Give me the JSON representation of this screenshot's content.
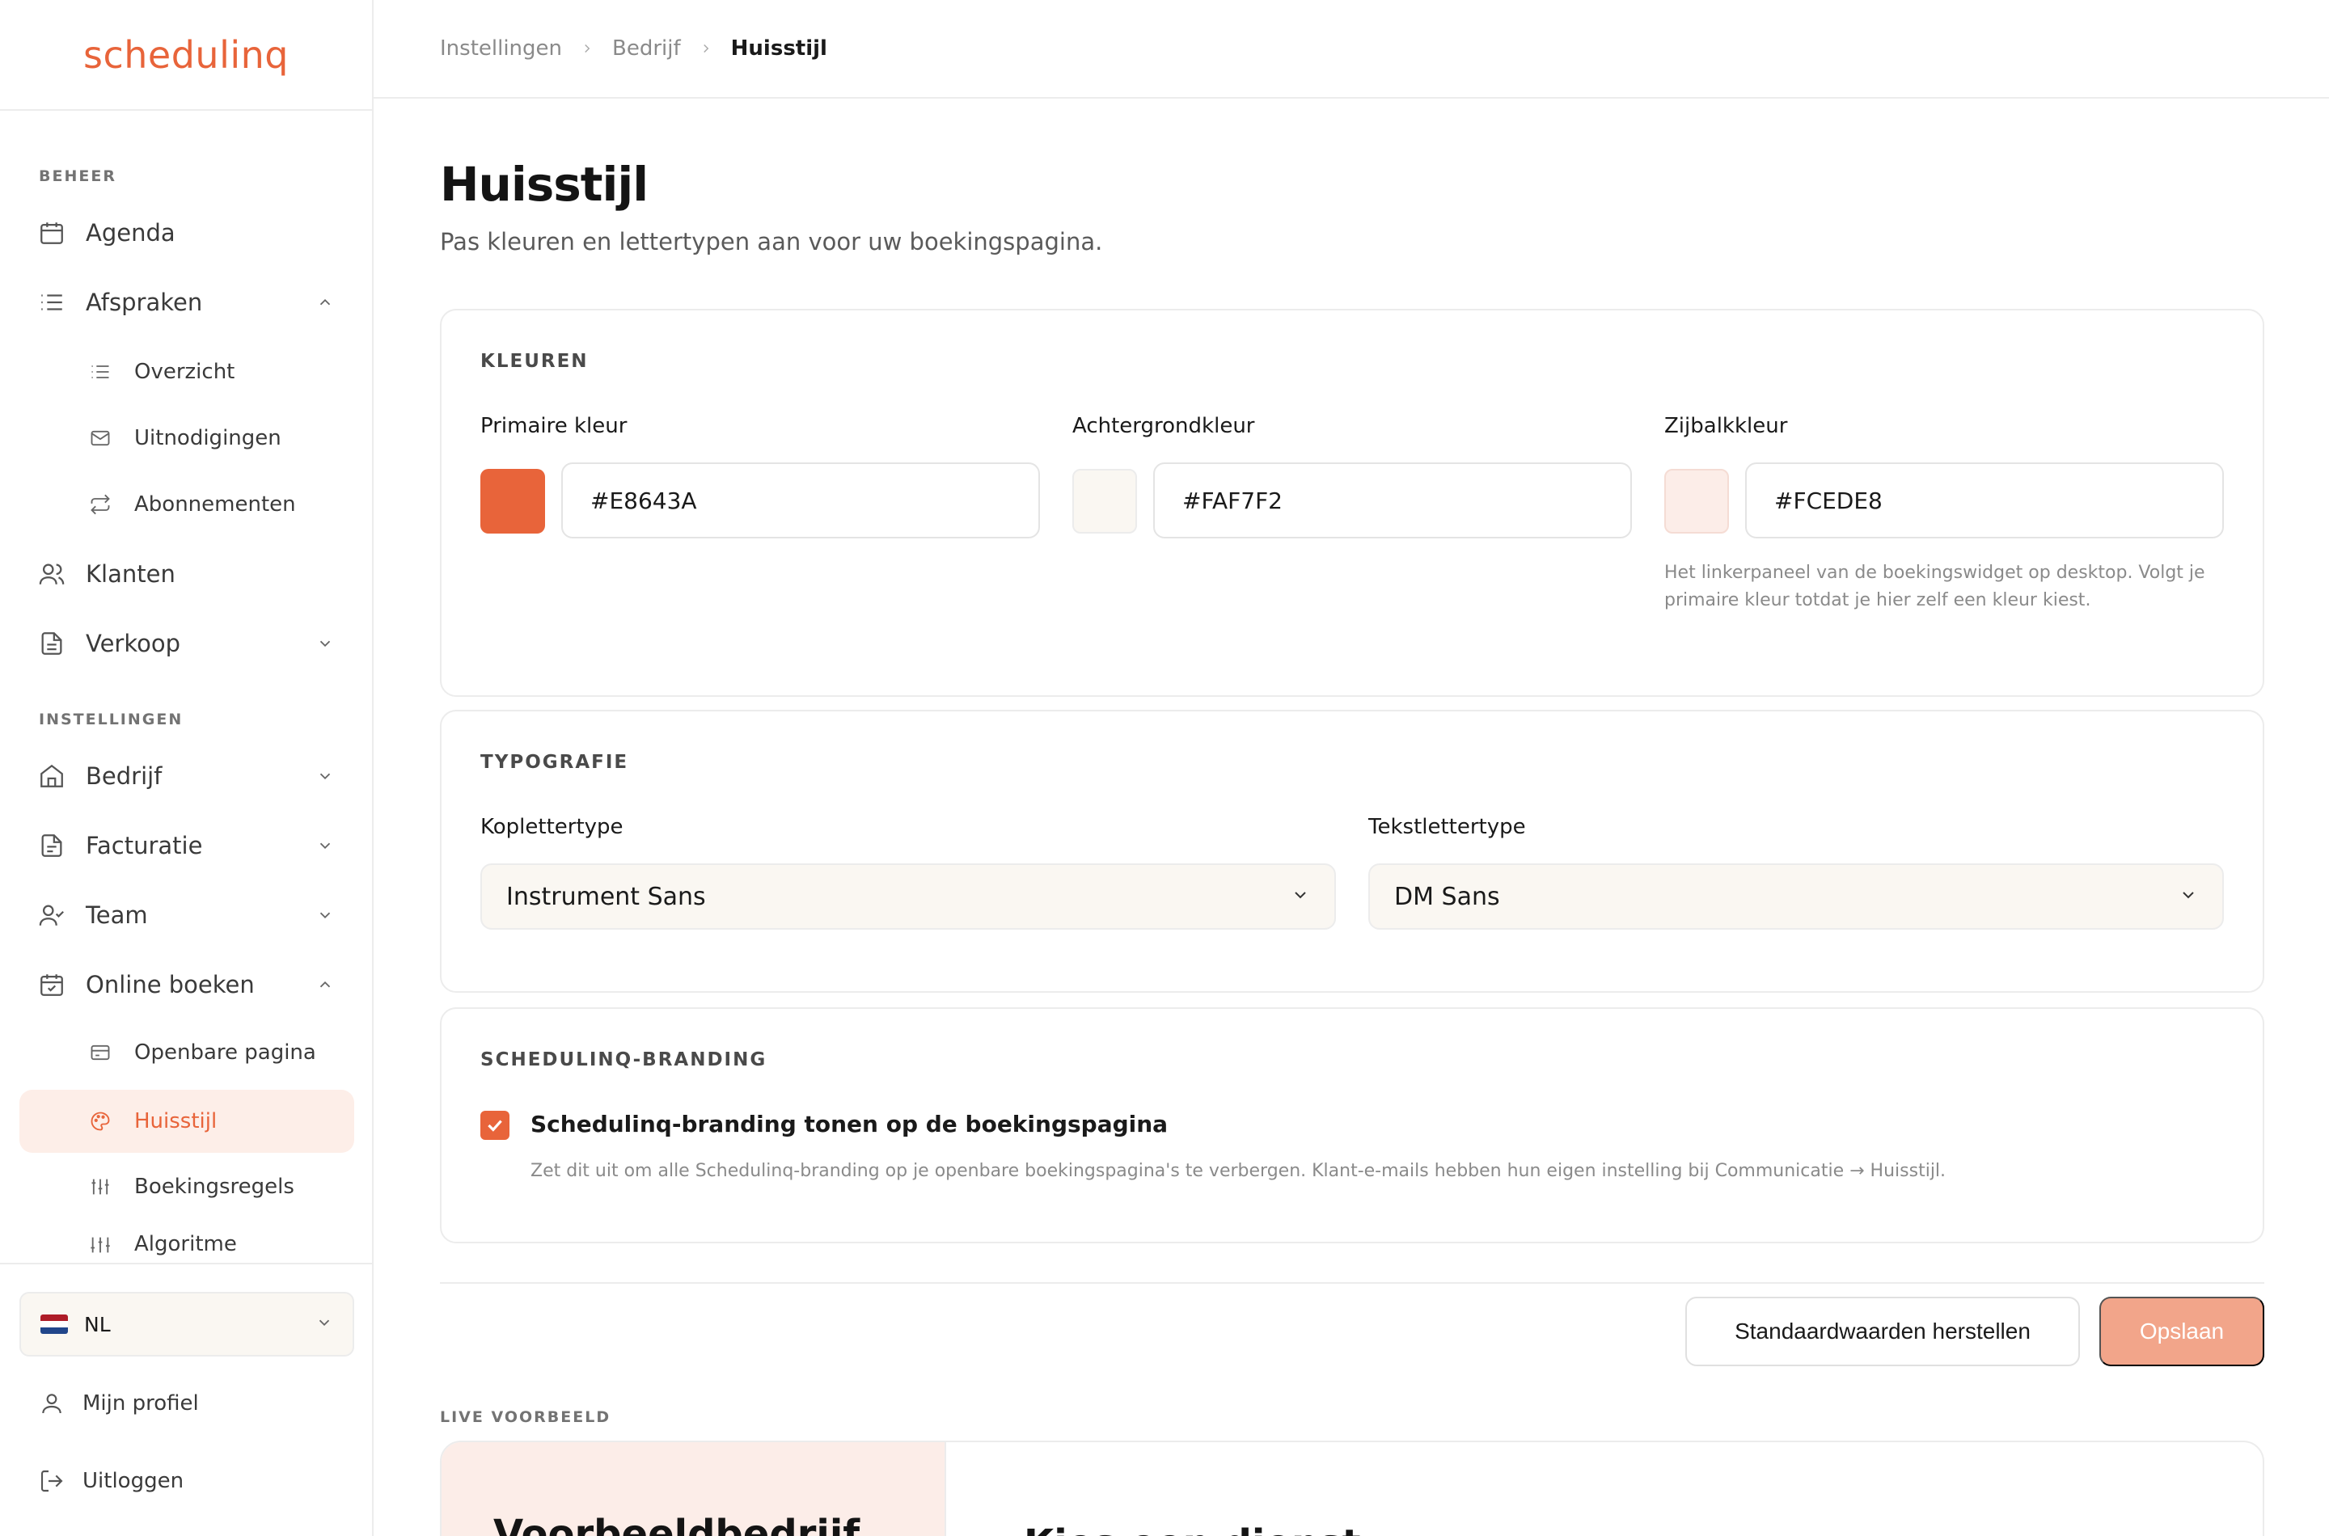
{
  "app": {
    "logo": "schedulinq"
  },
  "sidebar": {
    "section_beheer": "BEHEER",
    "section_instellingen": "INSTELLINGEN",
    "items": {
      "agenda": "Agenda",
      "afspraken": "Afspraken",
      "overzicht": "Overzicht",
      "uitnodigingen": "Uitnodigingen",
      "abonnementen": "Abonnementen",
      "klanten": "Klanten",
      "verkoop": "Verkoop",
      "bedrijf": "Bedrijf",
      "facturatie": "Facturatie",
      "team": "Team",
      "online_boeken": "Online boeken",
      "openbare_pagina": "Openbare pagina",
      "huisstijl": "Huisstijl",
      "boekingsregels": "Boekingsregels",
      "algoritme": "Algoritme"
    },
    "language": "NL",
    "profile": "Mijn profiel",
    "logout": "Uitloggen"
  },
  "breadcrumb": [
    "Instellingen",
    "Bedrijf",
    "Huisstijl"
  ],
  "page": {
    "title": "Huisstijl",
    "subtitle": "Pas kleuren en lettertypen aan voor uw boekingspagina."
  },
  "colors_card": {
    "title": "KLEUREN",
    "primary": {
      "label": "Primaire kleur",
      "value": "#E8643A",
      "swatch": "#E8643A"
    },
    "background": {
      "label": "Achtergrondkleur",
      "value": "#FAF7F2",
      "swatch": "#FAF7F2"
    },
    "sidebar": {
      "label": "Zijbalkkleur",
      "value": "#FCEDE8",
      "swatch": "#FCEDE8",
      "help": "Het linkerpaneel van de boekingswidget op desktop. Volgt je primaire kleur totdat je hier zelf een kleur kiest."
    }
  },
  "typography_card": {
    "title": "TYPOGRAFIE",
    "heading_font": {
      "label": "Koplettertype",
      "value": "Instrument Sans"
    },
    "body_font": {
      "label": "Tekstlettertype",
      "value": "DM Sans"
    }
  },
  "branding_card": {
    "title": "SCHEDULINQ-BRANDING",
    "checkbox_label": "Schedulinq-branding tonen op de boekingspagina",
    "checked": true,
    "help": "Zet dit uit om alle Schedulinq-branding op je openbare boekingspagina's te verbergen. Klant-e-mails hebben hun eigen instelling bij Communicatie → Huisstijl."
  },
  "actions": {
    "reset": "Standaardwaarden herstellen",
    "save": "Opslaan"
  },
  "preview": {
    "label": "LIVE VOORBEELD",
    "company": "Voorbeeldbedrijf",
    "heading": "Kies een dienst"
  },
  "theme": {
    "accent": "#E8643A",
    "active_bg": "#FDEEE8",
    "save_disabled": "#F2A58A"
  }
}
